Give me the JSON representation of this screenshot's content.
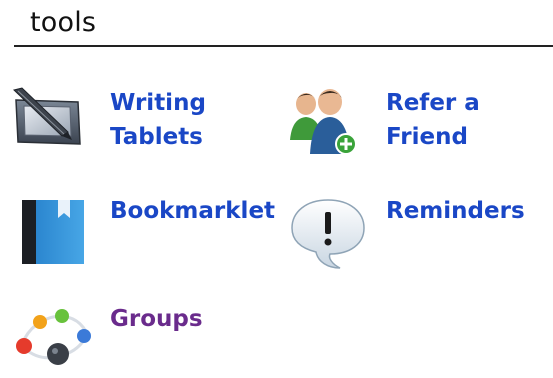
{
  "section": {
    "title": "tools"
  },
  "tools": [
    {
      "label": "Writing\nTablets",
      "icon": "writing-tablet-icon",
      "color": "#1a47c6"
    },
    {
      "label": "Refer a\nFriend",
      "icon": "refer-friend-icon",
      "color": "#1a47c6"
    },
    {
      "label": "Bookmarklet",
      "icon": "bookmark-icon",
      "color": "#1a47c6"
    },
    {
      "label": "Reminders",
      "icon": "reminder-speech-bubble-icon",
      "color": "#1a47c6"
    },
    {
      "label": "Groups",
      "icon": "groups-network-icon",
      "color": "#6a2b8c"
    }
  ]
}
